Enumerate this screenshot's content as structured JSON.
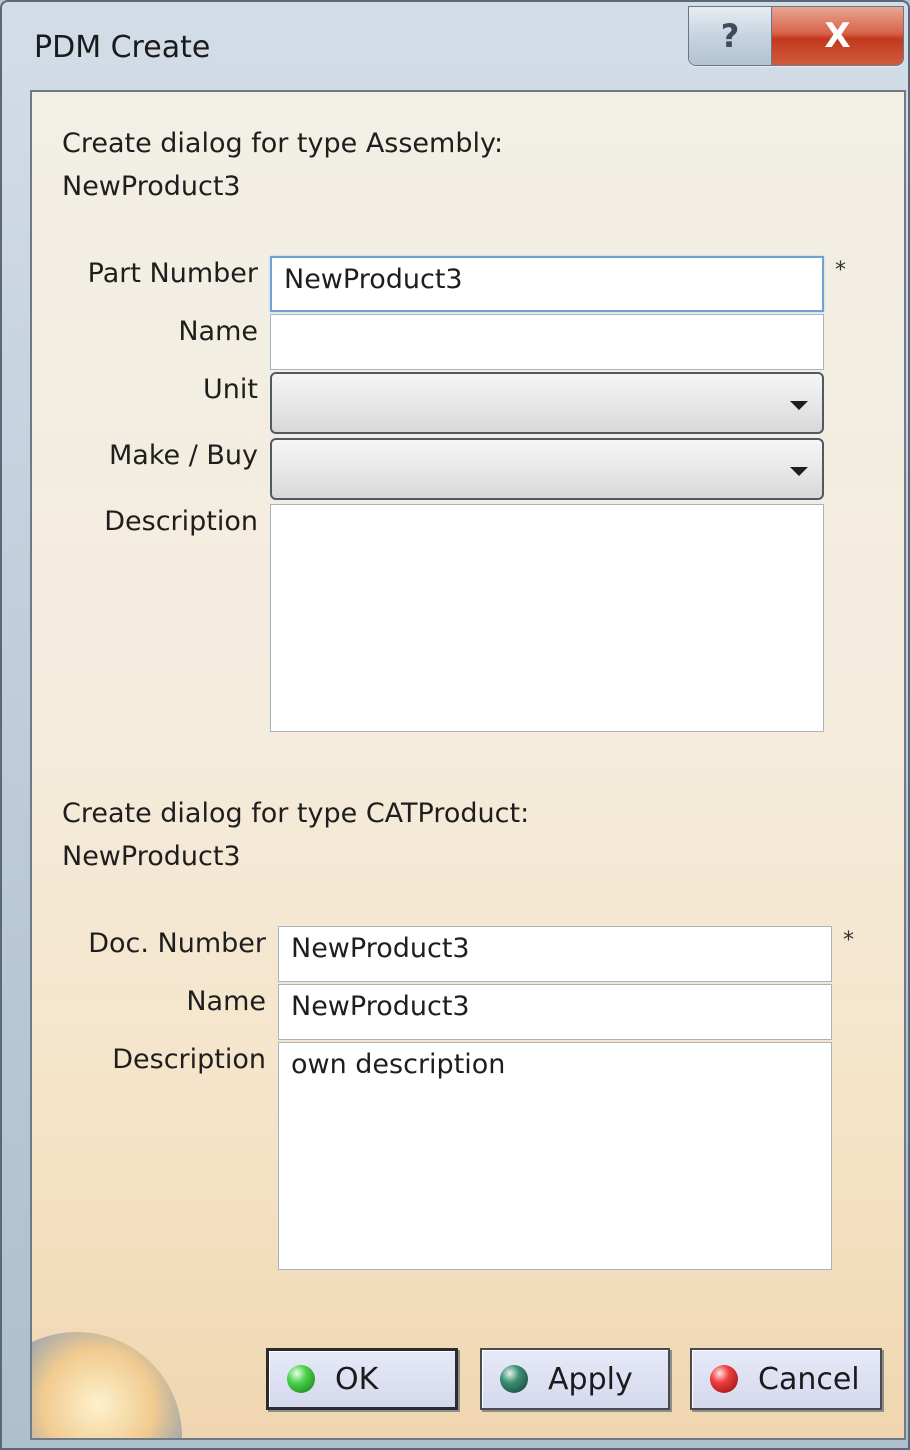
{
  "window": {
    "title": "PDM Create",
    "help_glyph": "?",
    "close_glyph": "X"
  },
  "assembly": {
    "heading_line1": "Create dialog for type Assembly:",
    "heading_line2": "NewProduct3",
    "fields": {
      "part_number": {
        "label": "Part Number",
        "value": "NewProduct3",
        "required_mark": "*"
      },
      "name": {
        "label": "Name",
        "value": ""
      },
      "unit": {
        "label": "Unit",
        "value": ""
      },
      "make_buy": {
        "label": "Make / Buy",
        "value": ""
      },
      "description": {
        "label": "Description",
        "value": ""
      }
    }
  },
  "catproduct": {
    "heading_line1": "Create dialog for type CATProduct:",
    "heading_line2": "NewProduct3",
    "fields": {
      "doc_number": {
        "label": "Doc. Number",
        "value": "NewProduct3",
        "required_mark": "*"
      },
      "name": {
        "label": "Name",
        "value": "NewProduct3"
      },
      "description": {
        "label": "Description",
        "value": "own description"
      }
    }
  },
  "buttons": {
    "ok": "OK",
    "apply": "Apply",
    "cancel": "Cancel"
  },
  "colors": {
    "ok_icon": "#2fae2f",
    "apply_icon": "#2a6b5a",
    "cancel_icon": "#d42525",
    "close_button": "#c8432a",
    "focus_border": "#6fa3d8"
  }
}
